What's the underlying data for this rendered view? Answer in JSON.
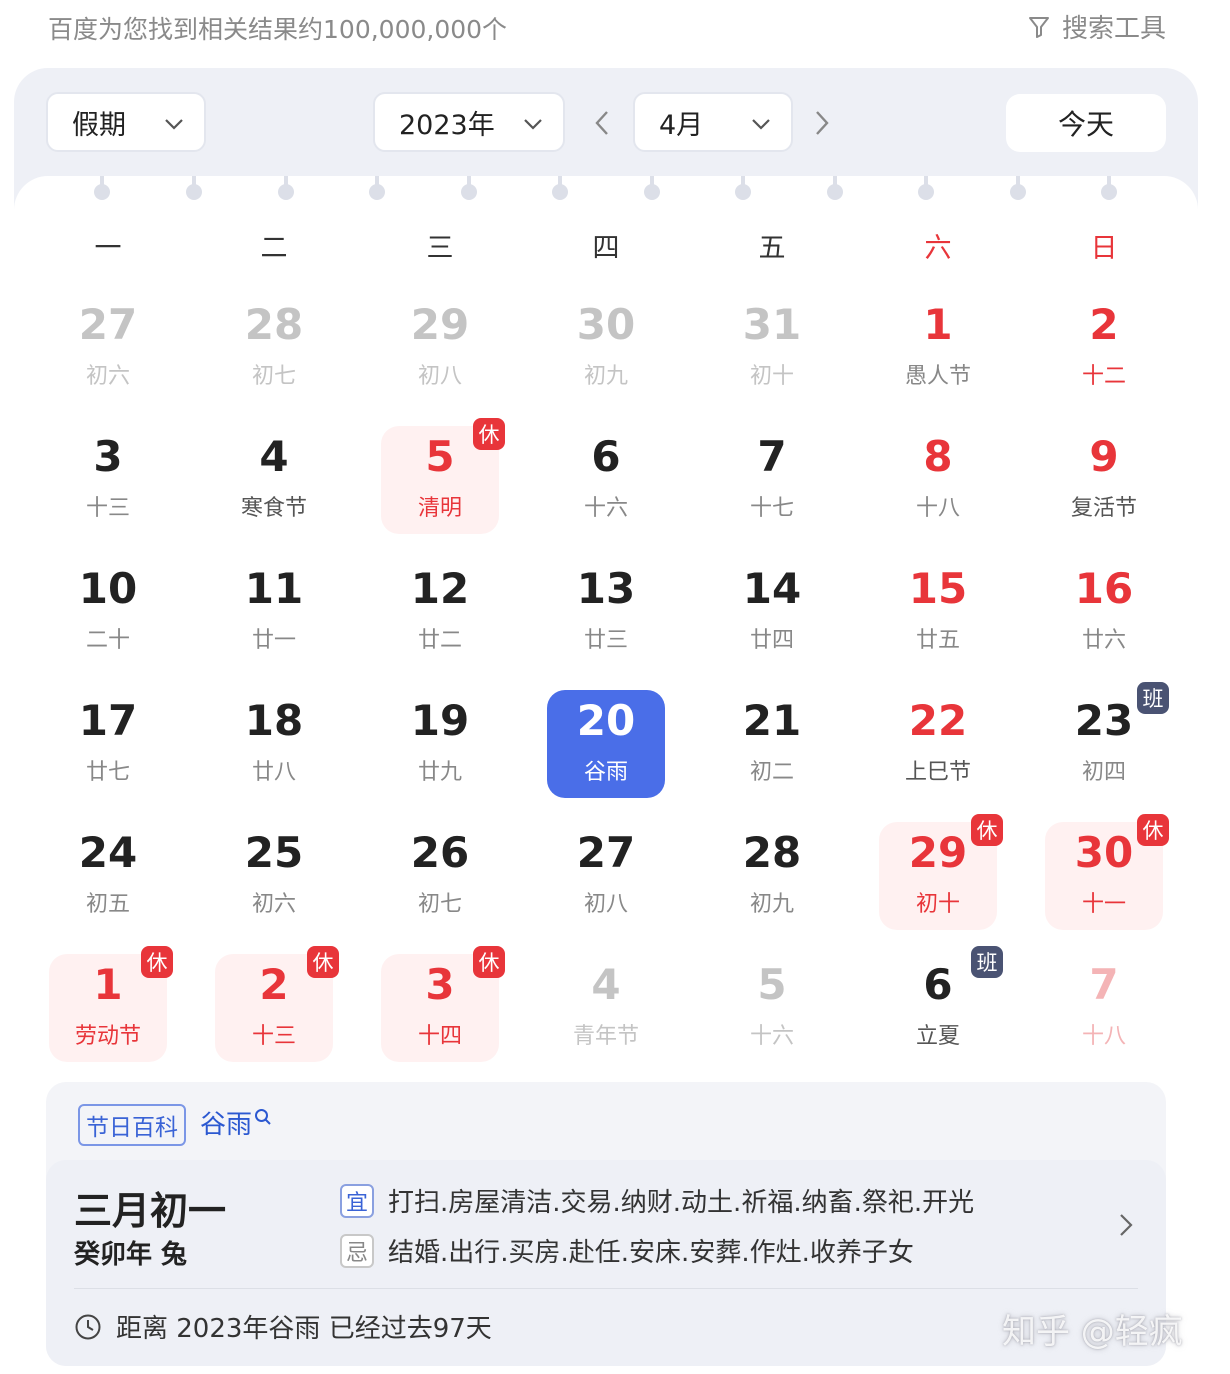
{
  "header": {
    "result_count": "百度为您找到相关结果约100,000,000个",
    "search_tools": "搜索工具"
  },
  "controls": {
    "holiday_select": "假期",
    "year_select": "2023年",
    "month_select": "4月",
    "today_button": "今天"
  },
  "weekdays": [
    "一",
    "二",
    "三",
    "四",
    "五",
    "六",
    "日"
  ],
  "weeks": [
    [
      {
        "day": "27",
        "lunar": "初六",
        "state": "dim"
      },
      {
        "day": "28",
        "lunar": "初七",
        "state": "dim"
      },
      {
        "day": "29",
        "lunar": "初八",
        "state": "dim"
      },
      {
        "day": "30",
        "lunar": "初九",
        "state": "dim"
      },
      {
        "day": "31",
        "lunar": "初十",
        "state": "dim"
      },
      {
        "day": "1",
        "lunar": "愚人节",
        "state": "red-day"
      },
      {
        "day": "2",
        "lunar": "十二",
        "state": "red"
      }
    ],
    [
      {
        "day": "3",
        "lunar": "十三",
        "state": "normal"
      },
      {
        "day": "4",
        "lunar": "寒食节",
        "state": "hl"
      },
      {
        "day": "5",
        "lunar": "清明",
        "state": "rest",
        "tag": "休"
      },
      {
        "day": "6",
        "lunar": "十六",
        "state": "normal"
      },
      {
        "day": "7",
        "lunar": "十七",
        "state": "normal"
      },
      {
        "day": "8",
        "lunar": "十八",
        "state": "red-day"
      },
      {
        "day": "9",
        "lunar": "复活节",
        "state": "red-day-hl"
      }
    ],
    [
      {
        "day": "10",
        "lunar": "二十",
        "state": "normal"
      },
      {
        "day": "11",
        "lunar": "廿一",
        "state": "normal"
      },
      {
        "day": "12",
        "lunar": "廿二",
        "state": "normal"
      },
      {
        "day": "13",
        "lunar": "廿三",
        "state": "normal"
      },
      {
        "day": "14",
        "lunar": "廿四",
        "state": "normal"
      },
      {
        "day": "15",
        "lunar": "廿五",
        "state": "red-day"
      },
      {
        "day": "16",
        "lunar": "廿六",
        "state": "red-day"
      }
    ],
    [
      {
        "day": "17",
        "lunar": "廿七",
        "state": "normal"
      },
      {
        "day": "18",
        "lunar": "廿八",
        "state": "normal"
      },
      {
        "day": "19",
        "lunar": "廿九",
        "state": "normal"
      },
      {
        "day": "20",
        "lunar": "谷雨",
        "state": "sel"
      },
      {
        "day": "21",
        "lunar": "初二",
        "state": "normal"
      },
      {
        "day": "22",
        "lunar": "上巳节",
        "state": "red-day-hl"
      },
      {
        "day": "23",
        "lunar": "初四",
        "state": "normal",
        "tag": "班"
      }
    ],
    [
      {
        "day": "24",
        "lunar": "初五",
        "state": "normal"
      },
      {
        "day": "25",
        "lunar": "初六",
        "state": "normal"
      },
      {
        "day": "26",
        "lunar": "初七",
        "state": "normal"
      },
      {
        "day": "27",
        "lunar": "初八",
        "state": "normal"
      },
      {
        "day": "28",
        "lunar": "初九",
        "state": "normal"
      },
      {
        "day": "29",
        "lunar": "初十",
        "state": "rest",
        "tag": "休"
      },
      {
        "day": "30",
        "lunar": "十一",
        "state": "rest",
        "tag": "休"
      }
    ],
    [
      {
        "day": "1",
        "lunar": "劳动节",
        "state": "rest",
        "tag": "休"
      },
      {
        "day": "2",
        "lunar": "十三",
        "state": "rest",
        "tag": "休"
      },
      {
        "day": "3",
        "lunar": "十四",
        "state": "rest",
        "tag": "休"
      },
      {
        "day": "4",
        "lunar": "青年节",
        "state": "dim"
      },
      {
        "day": "5",
        "lunar": "十六",
        "state": "dim"
      },
      {
        "day": "6",
        "lunar": "立夏",
        "state": "hl",
        "tag": "班"
      },
      {
        "day": "7",
        "lunar": "十八",
        "state": "dimred"
      }
    ]
  ],
  "detail": {
    "baike_tag": "节日百科",
    "baike_term": "谷雨",
    "lunar_date": "三月初一",
    "lunar_year": "癸卯年 兔",
    "yi_label": "宜",
    "yi_text": "打扫.房屋清洁.交易.纳财.动土.祈福.纳畜.祭祀.开光",
    "ji_label": "忌",
    "ji_text": "结婚.出行.买房.赴任.安床.安葬.作灶.收养子女",
    "since_text": "距离 2023年谷雨 已经过去97天"
  },
  "watermark": "知乎 @轻疯",
  "colors": {
    "red": "#e8353a",
    "selected": "#4a6ee8",
    "rest_bg": "#fff1f1",
    "work_tag": "#4a5373",
    "link": "#2b58d1"
  }
}
